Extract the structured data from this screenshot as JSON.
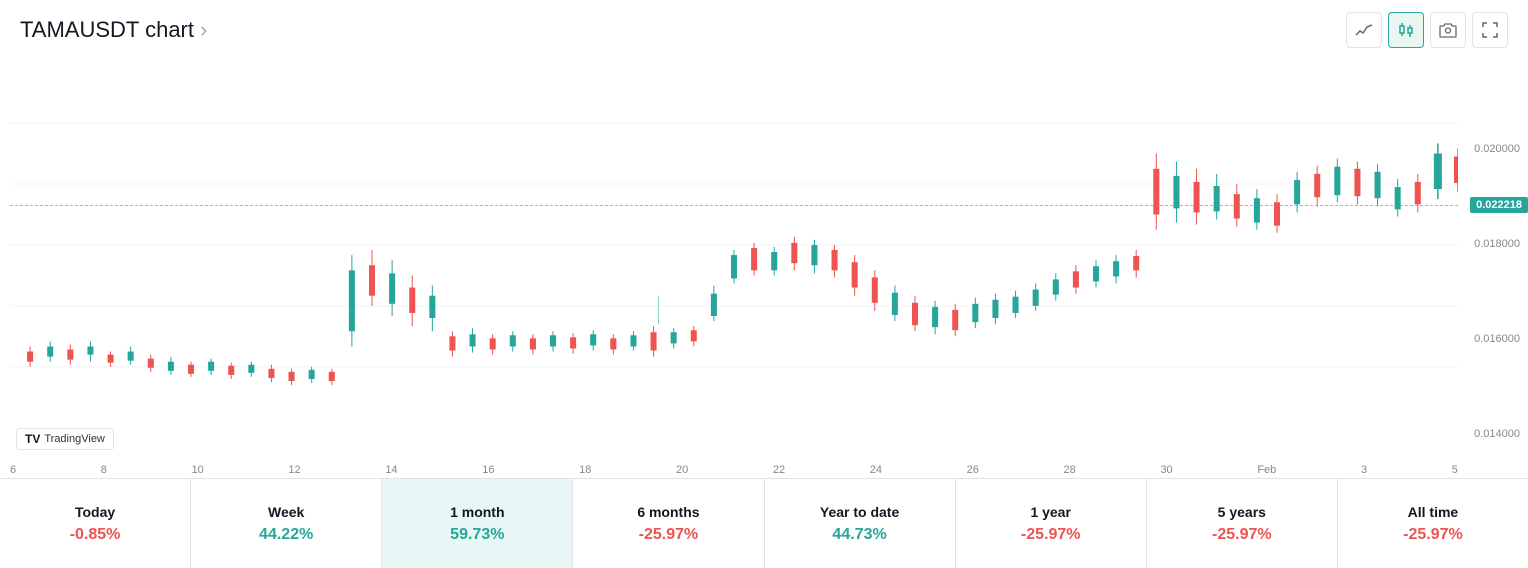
{
  "header": {
    "title": "TAMAUSDT chart",
    "title_arrow": "›"
  },
  "toolbar": {
    "line_icon": "〜",
    "candle_icon": "⬧",
    "camera_icon": "📷",
    "fullscreen_icon": "⛶",
    "embed_icon": "</>"
  },
  "chart": {
    "current_price": "0.022218",
    "dashed_line_top_pct": 36,
    "y_labels": [
      "0.022218",
      "0.020000",
      "0.018000",
      "0.016000",
      "0.014000"
    ],
    "x_labels": [
      "6",
      "8",
      "10",
      "12",
      "14",
      "16",
      "18",
      "20",
      "22",
      "24",
      "26",
      "28",
      "30",
      "Feb",
      "3",
      "5"
    ]
  },
  "periods": [
    {
      "label": "Today",
      "value": "-0.85%",
      "type": "negative"
    },
    {
      "label": "Week",
      "value": "44.22%",
      "type": "positive"
    },
    {
      "label": "1 month",
      "value": "59.73%",
      "type": "positive",
      "active": true
    },
    {
      "label": "6 months",
      "value": "-25.97%",
      "type": "negative"
    },
    {
      "label": "Year to date",
      "value": "44.73%",
      "type": "positive"
    },
    {
      "label": "1 year",
      "value": "-25.97%",
      "type": "negative"
    },
    {
      "label": "5 years",
      "value": "-25.97%",
      "type": "negative"
    },
    {
      "label": "All time",
      "value": "-25.97%",
      "type": "negative"
    }
  ],
  "tradingview": {
    "logo": "TV",
    "label": "TradingView"
  }
}
